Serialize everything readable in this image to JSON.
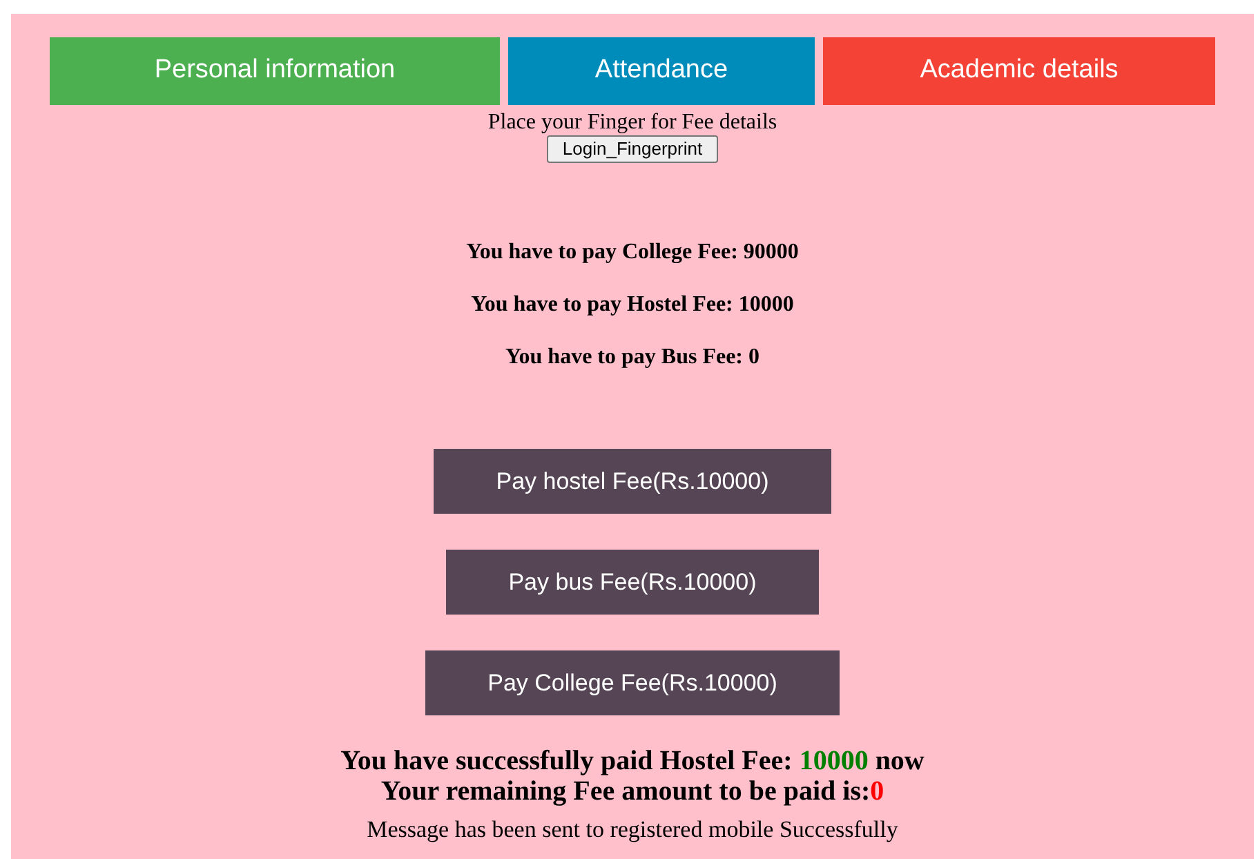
{
  "tabs": [
    {
      "label": "Personal information",
      "color": "#4caf50"
    },
    {
      "label": "Attendance",
      "color": "#008cba"
    },
    {
      "label": "Academic details",
      "color": "#f44336"
    }
  ],
  "prompt": "Place your Finger for Fee details",
  "login_button": "Login_Fingerprint",
  "fees": [
    "You have to pay College Fee: 90000",
    "You have to pay Hostel Fee: 10000",
    "You have to pay Bus Fee: 0"
  ],
  "pay_buttons": [
    "Pay hostel Fee(Rs.10000)",
    "Pay bus Fee(Rs.10000)",
    "Pay College Fee(Rs.10000)"
  ],
  "paid": {
    "prefix": "You have successfully paid Hostel Fee: ",
    "amount": "10000",
    "suffix": " now"
  },
  "remaining": {
    "prefix": "Your remaining Fee amount to be paid is:",
    "amount": "0"
  },
  "message": "Message has been sent to registered mobile Successfully"
}
